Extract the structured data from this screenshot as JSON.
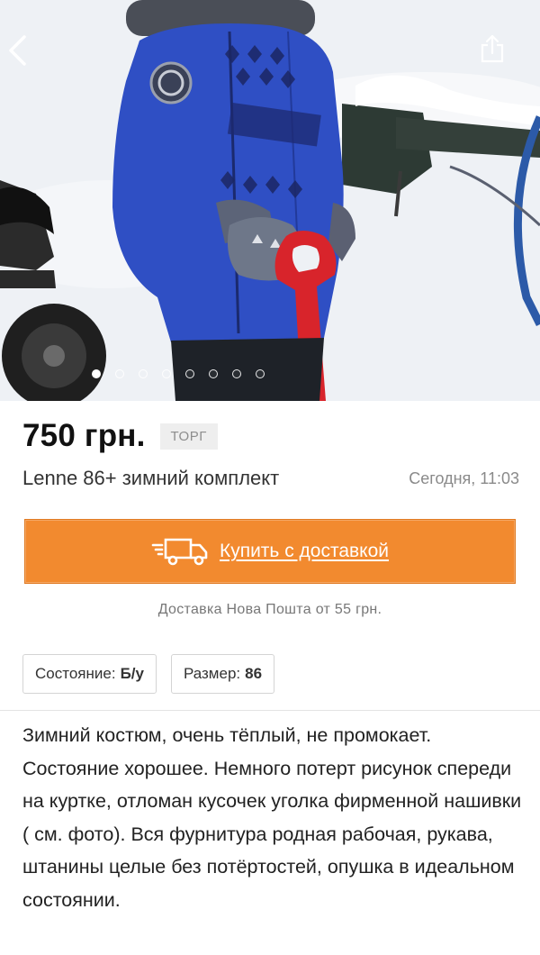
{
  "header": {
    "back_icon": "chevron-left-icon",
    "share_icon": "share-icon"
  },
  "gallery": {
    "total_photos": 8,
    "active_index": 0
  },
  "listing": {
    "price": "750 грн.",
    "bargain_badge": "ТОРГ",
    "title": "Lenne 86+ зимний комплект",
    "posted": "Сегодня, 11:03"
  },
  "buy": {
    "label": "Купить с доставкой",
    "icon": "delivery-truck-icon",
    "note": "Доставка Нова Пошта от 55 грн."
  },
  "params": [
    {
      "label": "Состояние:",
      "value": "Б/у"
    },
    {
      "label": "Размер:",
      "value": "86"
    }
  ],
  "description": "Зимний костюм, очень тёплый, не промокает. Состояние хорошее. Немного потерт рисунок спереди на куртке, отломан кусочек уголка фирменной нашивки ( см. фото). Вся фурнитура родная рабочая, рукава, штанины целые без потёртостей, опушка в идеальном состоянии.",
  "colors": {
    "accent": "#f28a2f",
    "jacket": "#2f4fc4"
  }
}
